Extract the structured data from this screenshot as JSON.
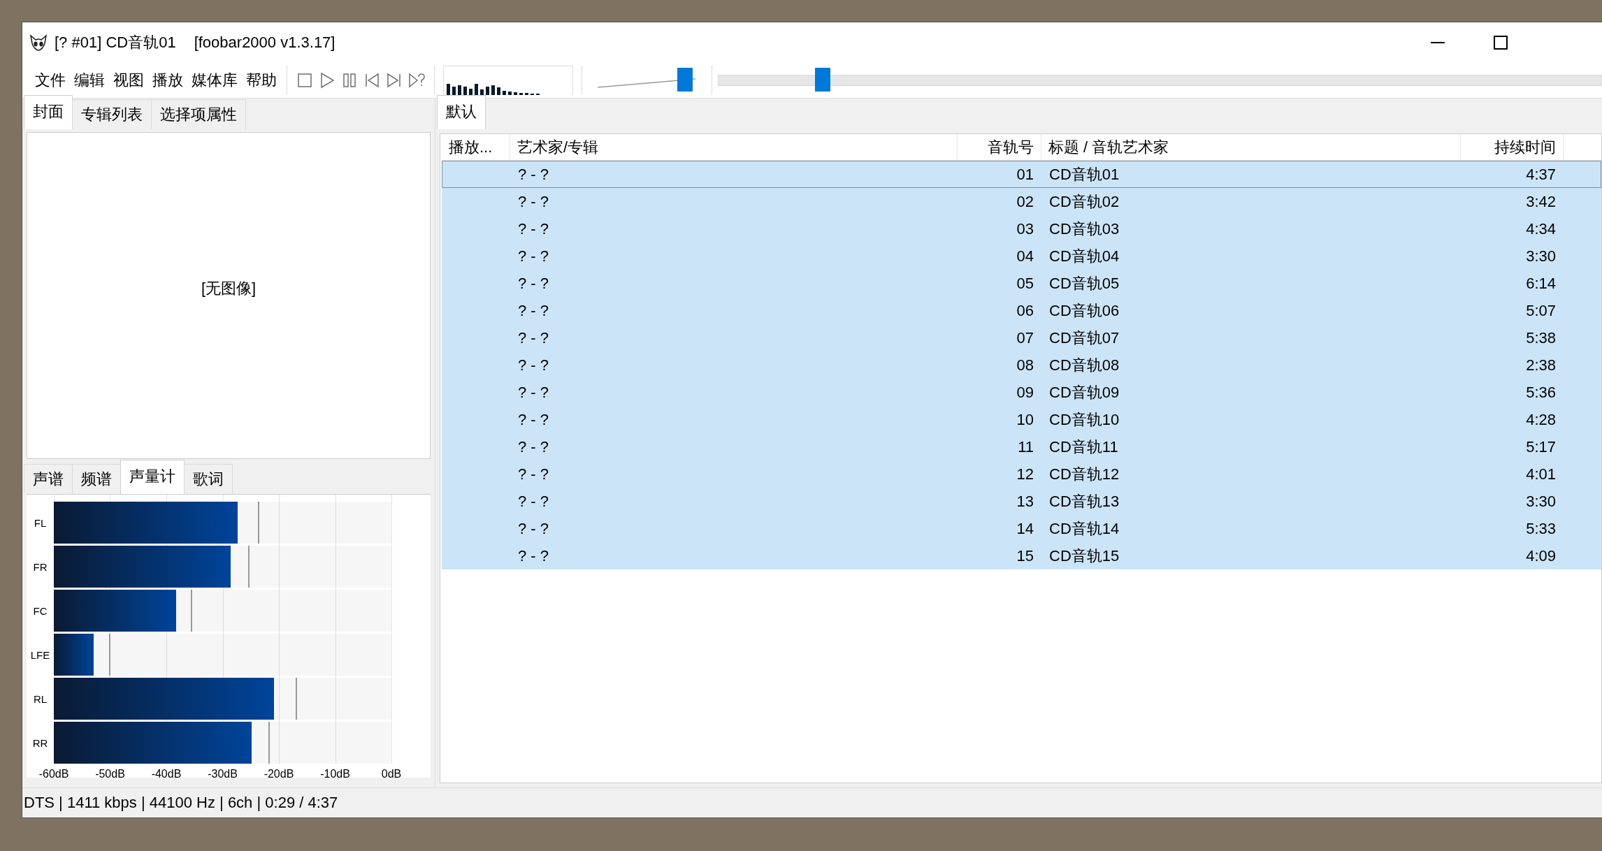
{
  "window": {
    "title": "[? #01] CD音轨01",
    "app_version": "[foobar2000 v1.3.17]"
  },
  "menu": [
    "文件",
    "编辑",
    "视图",
    "播放",
    "媒体库",
    "帮助"
  ],
  "volume": {
    "level": 0.93
  },
  "seekbar": {
    "level": 0.11
  },
  "left_tabs": [
    {
      "label": "封面",
      "selected": true
    },
    {
      "label": "专辑列表",
      "selected": false
    },
    {
      "label": "选择项属性",
      "selected": false
    }
  ],
  "cover": {
    "text": "[无图像]"
  },
  "visual_tabs": [
    {
      "label": "声谱",
      "selected": false
    },
    {
      "label": "频谱",
      "selected": false
    },
    {
      "label": "声量计",
      "selected": true
    },
    {
      "label": "歌词",
      "selected": false
    }
  ],
  "meter": {
    "channels": [
      {
        "name": "FL",
        "level": 0.544,
        "peak": {
          "level": 0.607
        }
      },
      {
        "name": "FR",
        "level": 0.523,
        "peak": {
          "level": 0.577
        }
      },
      {
        "name": "FC",
        "level": 0.363,
        "peak": {
          "level": 0.408
        }
      },
      {
        "name": "LFE",
        "level": 0.118,
        "peak": {
          "level": 0.166
        }
      },
      {
        "name": "RL",
        "level": 0.653,
        "peak": {
          "level": 0.719
        }
      },
      {
        "name": "RR",
        "level": 0.586,
        "peak": {
          "level": 0.637
        }
      }
    ],
    "scale": [
      "-60dB",
      "-50dB",
      "-40dB",
      "-30dB",
      "-20dB",
      "-10dB",
      "0dB"
    ]
  },
  "playlist_tabs": [
    {
      "label": "默认",
      "selected": true
    }
  ],
  "table": {
    "columns": [
      "播放...",
      "艺术家/专辑",
      "音轨号",
      "标题 / 音轨艺术家",
      "持续时间"
    ],
    "rows": [
      {
        "artist": "? - ?",
        "track": "01",
        "title": "CD音轨01",
        "duration": "4:37",
        "selected": true,
        "focused": true
      },
      {
        "artist": "? - ?",
        "track": "02",
        "title": "CD音轨02",
        "duration": "3:42",
        "selected": true,
        "focused": false
      },
      {
        "artist": "? - ?",
        "track": "03",
        "title": "CD音轨03",
        "duration": "4:34",
        "selected": true,
        "focused": false
      },
      {
        "artist": "? - ?",
        "track": "04",
        "title": "CD音轨04",
        "duration": "3:30",
        "selected": true,
        "focused": false
      },
      {
        "artist": "? - ?",
        "track": "05",
        "title": "CD音轨05",
        "duration": "6:14",
        "selected": true,
        "focused": false
      },
      {
        "artist": "? - ?",
        "track": "06",
        "title": "CD音轨06",
        "duration": "5:07",
        "selected": true,
        "focused": false
      },
      {
        "artist": "? - ?",
        "track": "07",
        "title": "CD音轨07",
        "duration": "5:38",
        "selected": true,
        "focused": false
      },
      {
        "artist": "? - ?",
        "track": "08",
        "title": "CD音轨08",
        "duration": "2:38",
        "selected": true,
        "focused": false
      },
      {
        "artist": "? - ?",
        "track": "09",
        "title": "CD音轨09",
        "duration": "5:36",
        "selected": true,
        "focused": false
      },
      {
        "artist": "? - ?",
        "track": "10",
        "title": "CD音轨10",
        "duration": "4:28",
        "selected": true,
        "focused": false
      },
      {
        "artist": "? - ?",
        "track": "11",
        "title": "CD音轨11",
        "duration": "5:17",
        "selected": true,
        "focused": false
      },
      {
        "artist": "? - ?",
        "track": "12",
        "title": "CD音轨12",
        "duration": "4:01",
        "selected": true,
        "focused": false
      },
      {
        "artist": "? - ?",
        "track": "13",
        "title": "CD音轨13",
        "duration": "3:30",
        "selected": true,
        "focused": false
      },
      {
        "artist": "? - ?",
        "track": "14",
        "title": "CD音轨14",
        "duration": "5:33",
        "selected": true,
        "focused": false
      },
      {
        "artist": "? - ?",
        "track": "15",
        "title": "CD音轨15",
        "duration": "4:09",
        "selected": true,
        "focused": false
      }
    ]
  },
  "status_bar": "DTS | 1411 kbps | 44100 Hz | 6ch | 0:29 / 4:37"
}
